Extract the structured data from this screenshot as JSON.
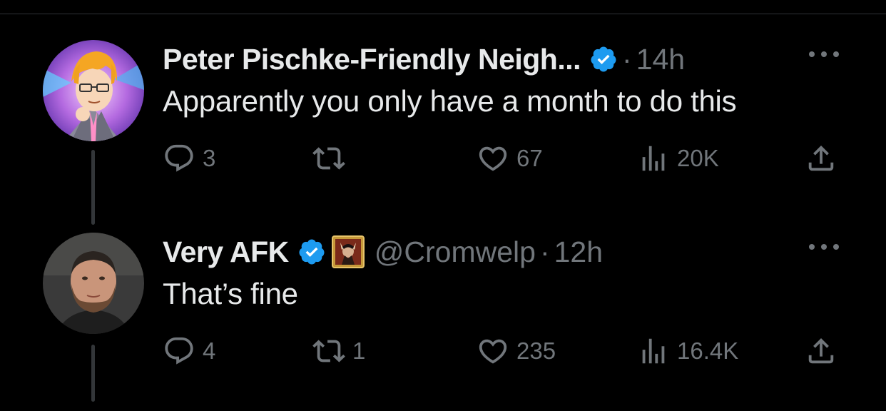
{
  "tweets": [
    {
      "name": "Peter Pischke-Friendly Neigh...",
      "handle": "",
      "separator": "·",
      "time": "14h",
      "text": "Apparently you only have a month to do this",
      "replies": "3",
      "retweets": "",
      "likes": "67",
      "views": "20K",
      "verified": true,
      "avatar_icon": "anime-character-avatar"
    },
    {
      "name": "Very AFK",
      "handle": "@Cromwelp",
      "separator": "·",
      "time": "12h",
      "text": "That’s fine",
      "replies": "4",
      "retweets": "1",
      "likes": "235",
      "views": "16.4K",
      "verified": true,
      "avatar_icon": "bearded-man-avatar",
      "affiliate_badge_icon": "game-character-badge-icon"
    }
  ],
  "colors": {
    "background": "#000000",
    "text": "#e7e9ea",
    "muted": "#71767b",
    "verified_blue": "#1d9bf0"
  }
}
